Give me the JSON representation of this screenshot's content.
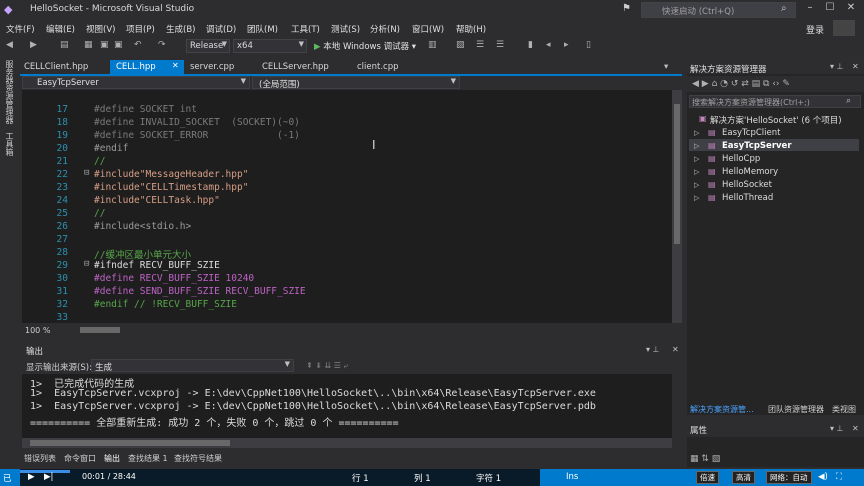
{
  "window": {
    "title": "HelloSocket - Microsoft Visual Studio",
    "quick_launch_placeholder": "快速启动 (Ctrl+Q)",
    "login": "登录"
  },
  "menu": [
    "文件(F)",
    "编辑(E)",
    "视图(V)",
    "项目(P)",
    "生成(B)",
    "调试(D)",
    "团队(M)",
    "工具(T)",
    "测试(S)",
    "分析(N)",
    "窗口(W)",
    "帮助(H)"
  ],
  "toolbar": {
    "configuration": "Release",
    "platform": "x64",
    "run_label": "本地 Windows 调试器"
  },
  "left_strip": [
    "服务器资源管理器",
    "工具箱"
  ],
  "doc_tabs": [
    {
      "label": "CELLClient.hpp",
      "active": false
    },
    {
      "label": "CELL.hpp",
      "active": true
    },
    {
      "label": "server.cpp",
      "active": false
    },
    {
      "label": "CELLServer.hpp",
      "active": false
    },
    {
      "label": "client.cpp",
      "active": false
    }
  ],
  "nav": {
    "project": "EasyTcpServer",
    "scope": "(全局范围)"
  },
  "editor": {
    "zoom": "100 %",
    "lines": [
      {
        "n": "17",
        "code": "#define SOCKET int"
      },
      {
        "n": "18",
        "code": "#define INVALID_SOCKET  (SOCKET)(~0)"
      },
      {
        "n": "19",
        "code": "#define SOCKET_ERROR            (-1)"
      },
      {
        "n": "20",
        "code": "#endif"
      },
      {
        "n": "21",
        "code": "//"
      },
      {
        "n": "22",
        "code": "#include\"MessageHeader.hpp\""
      },
      {
        "n": "23",
        "code": "#include\"CELLTimestamp.hpp\""
      },
      {
        "n": "24",
        "code": "#include\"CELLTask.hpp\""
      },
      {
        "n": "25",
        "code": "//"
      },
      {
        "n": "26",
        "code": "#include<stdio.h>"
      },
      {
        "n": "27",
        "code": ""
      },
      {
        "n": "28",
        "code": "//缓冲区最小单元大小"
      },
      {
        "n": "29",
        "code": "#ifndef RECV_BUFF_SZIE"
      },
      {
        "n": "30",
        "code": "#define RECV_BUFF_SZIE 10240"
      },
      {
        "n": "31",
        "code": "#define SEND_BUFF_SZIE RECV_BUFF_SZIE"
      },
      {
        "n": "32",
        "code": "#endif // !RECV_BUFF_SZIE"
      },
      {
        "n": "33",
        "code": ""
      }
    ]
  },
  "output": {
    "title": "输出",
    "source_label": "显示输出来源(S):",
    "source_value": "生成",
    "lines": [
      "1>  已完成代码的生成",
      "1>  EasyTcpServer.vcxproj -> E:\\dev\\CppNet100\\HelloSocket\\..\\bin\\x64\\Release\\EasyTcpServer.exe",
      "1>  EasyTcpServer.vcxproj -> E:\\dev\\CppNet100\\HelloSocket\\..\\bin\\x64\\Release\\EasyTcpServer.pdb",
      "========== 全部重新生成: 成功 2 个，失败 0 个，跳过 0 个 =========="
    ]
  },
  "bottom_tabs": [
    "错误列表",
    "命令窗口",
    "输出",
    "查找结果 1",
    "查找符号结果"
  ],
  "status": {
    "ready": "已",
    "row": "行 1",
    "col": "列 1",
    "char": "字符 1",
    "ins": "Ins"
  },
  "video": {
    "time": "00:01 / 28:44",
    "progress": 0.0006,
    "speed": "倍速",
    "quality": "高清",
    "network": "网络：自动"
  },
  "solution_explorer": {
    "title": "解决方案资源管理器",
    "search_placeholder": "搜索解决方案资源管理器(Ctrl+;)",
    "solution": "解决方案'HelloSocket' (6 个项目)",
    "projects": [
      "EasyTcpClient",
      "EasyTcpServer",
      "HelloCpp",
      "HelloMemory",
      "HelloSocket",
      "HelloThread"
    ],
    "bottom_tabs": [
      "解决方案资源管...",
      "团队资源管理器",
      "类视图"
    ]
  },
  "properties": {
    "title": "属性"
  }
}
